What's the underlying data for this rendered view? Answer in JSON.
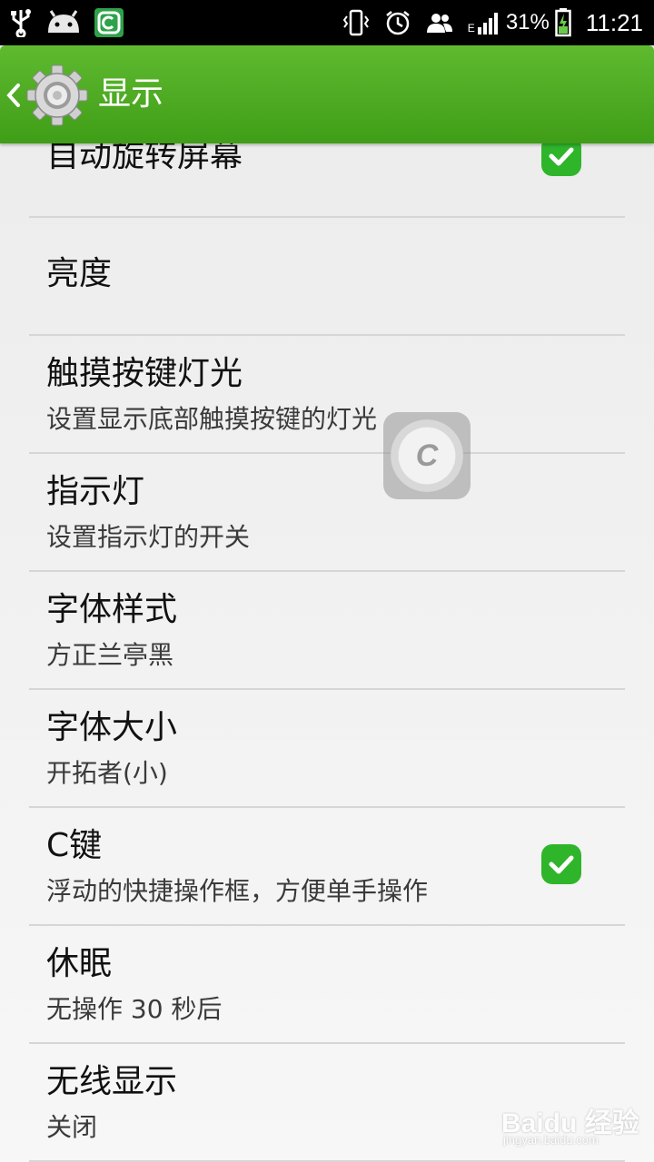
{
  "status_bar": {
    "icons_left": [
      "usb-icon",
      "android-icon",
      "app-c-icon"
    ],
    "icons_right": [
      "vibrate-icon",
      "alarm-icon",
      "contacts-icon",
      "signal-icon",
      "battery-charging-icon"
    ],
    "network_type": "E",
    "battery_percent": "31%",
    "time": "11:21"
  },
  "action_bar": {
    "title": "显示",
    "accent_color": "#4aa820"
  },
  "settings": {
    "auto_rotate": {
      "title": "自动旋转屏幕",
      "checked": true
    },
    "brightness": {
      "title": "亮度"
    },
    "touch_key_light": {
      "title": "触摸按键灯光",
      "summary": "设置显示底部触摸按键的灯光"
    },
    "indicator": {
      "title": "指示灯",
      "summary": "设置指示灯的开关"
    },
    "font_style": {
      "title": "字体样式",
      "summary": "方正兰亭黑"
    },
    "font_size": {
      "title": "字体大小",
      "summary": "开拓者(小)"
    },
    "c_key": {
      "title": "C键",
      "summary": "浮动的快捷操作框，方便单手操作",
      "checked": true
    },
    "sleep": {
      "title": "休眠",
      "summary": "无操作 30 秒后"
    },
    "wireless_display": {
      "title": "无线显示",
      "summary": "关闭"
    }
  },
  "floating_button": {
    "label": "C"
  },
  "watermark": {
    "main": "Baidu 经验",
    "sub": "jingyan.baidu.com"
  },
  "colors": {
    "check_green": "#2fb52a",
    "divider": "#d6d6d6",
    "status_bar_bg": "#000000"
  }
}
